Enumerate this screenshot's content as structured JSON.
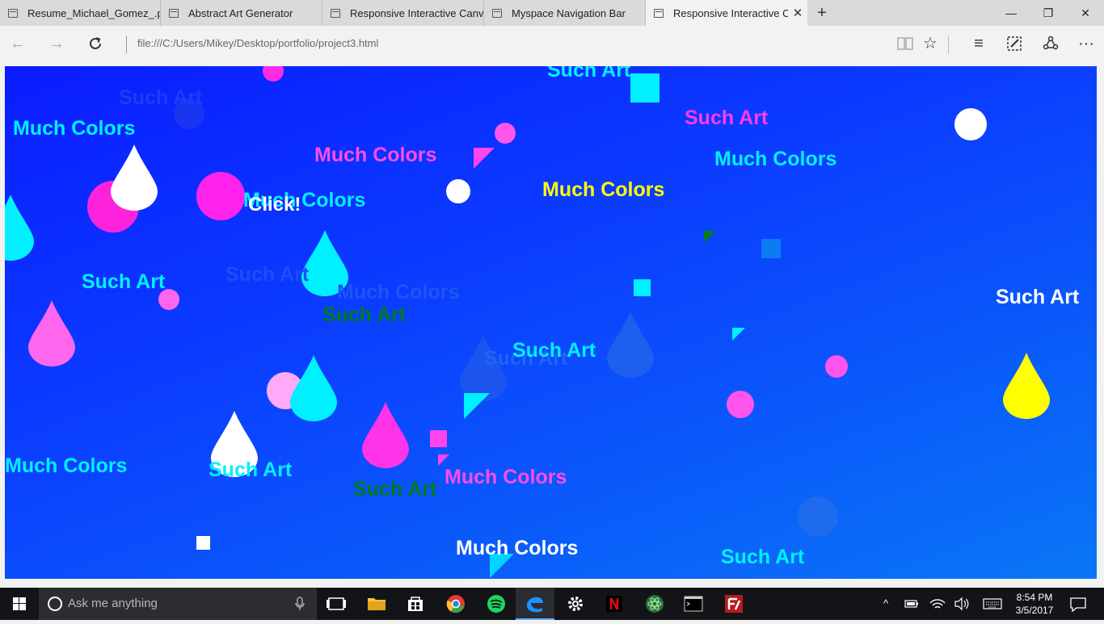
{
  "browser": {
    "tabs": [
      {
        "label": "Resume_Michael_Gomez_.p",
        "active": false
      },
      {
        "label": "Abstract Art Generator",
        "active": false
      },
      {
        "label": "Responsive Interactive Canv",
        "active": false
      },
      {
        "label": "Myspace Navigation Bar",
        "active": false
      },
      {
        "label": "Responsive Interactive C",
        "active": true
      }
    ],
    "address": "file:///C:/Users/Mikey/Desktop/portfolio/project3.html"
  },
  "canvas": {
    "click_label": "Click!",
    "texts": [
      {
        "text": "Such Art",
        "color": "#00f0ff"
      },
      {
        "text": "Such Art",
        "color": "#1c3df5"
      },
      {
        "text": "Much Colors",
        "color": "#00f0ff"
      },
      {
        "text": "Such Art",
        "color": "#ff3cf0"
      },
      {
        "text": "Much Colors",
        "color": "#ff4cec"
      },
      {
        "text": "Much Colors",
        "color": "#00f0ff"
      },
      {
        "text": "Much Colors",
        "color": "#00f0ff"
      },
      {
        "text": "Much Colors",
        "color": "#ffff00"
      },
      {
        "text": "Such Art",
        "color": "#00f0ff"
      },
      {
        "text": "Such Art",
        "color": "#1e4ef5"
      },
      {
        "text": "Much Colors",
        "color": "#1e56f5"
      },
      {
        "text": "Such Art",
        "color": "#007a1e"
      },
      {
        "text": "Such Art",
        "color": "#ffffff"
      },
      {
        "text": "Such Art",
        "color": "#1f66f3"
      },
      {
        "text": "Such Art",
        "color": "#00f0ff"
      },
      {
        "text": "Much Colors",
        "color": "#00f0ff"
      },
      {
        "text": "Such Art",
        "color": "#00f0ff"
      },
      {
        "text": "Such Art",
        "color": "#007a1e"
      },
      {
        "text": "Much Colors",
        "color": "#ff4cec"
      },
      {
        "text": "Much Colors",
        "color": "#ffffff"
      },
      {
        "text": "Such Art",
        "color": "#00f0ff"
      }
    ]
  },
  "taskbar": {
    "search_placeholder": "Ask me anything",
    "time": "8:54 PM",
    "date": "3/5/2017"
  }
}
